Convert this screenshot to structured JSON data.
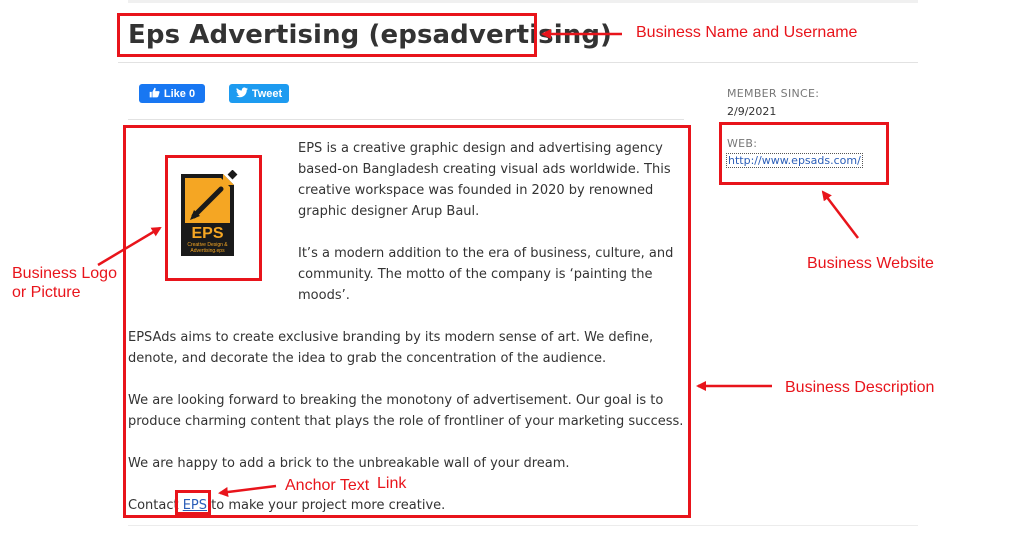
{
  "profile": {
    "title": "Eps Advertising (epsadvertising)"
  },
  "share": {
    "like_label": "Like 0",
    "tweet_label": "Tweet"
  },
  "sidebar": {
    "member_since_label": "MEMBER SINCE:",
    "member_since_value": "2/9/2021",
    "web_label": "WEB:",
    "web_url": "http://www.epsads.com/"
  },
  "logo": {
    "big": "EPS",
    "small1": "Creative Design &",
    "small2": "Advertising.eps"
  },
  "description": {
    "p1_lines": [
      "EPS is a creative graphic design and advertising agency",
      "based-on Bangladesh creating visual ads worldwide. This",
      "creative workspace was founded in 2020 by renowned",
      "graphic designer Arup Baul."
    ],
    "p2_lines": [
      "It’s a modern addition to the era of business, culture, and",
      "community. The motto of the company is ‘painting the",
      "moods’."
    ],
    "p3_lines": [
      "EPSAds aims to create exclusive branding by its modern sense of art. We define,",
      "denote, and decorate the idea to grab the concentration of the audience."
    ],
    "p4_lines": [
      "We are looking forward to breaking the monotony of advertisement. Our goal is to",
      "produce charming content that plays the role of frontliner of your marketing success."
    ],
    "p5": "We are happy to add a brick to the unbreakable wall of your dream.",
    "contact_before": "Contact ",
    "contact_link": "EPS",
    "contact_after": " to make your project more creative."
  },
  "annotations": {
    "business_name": "Business Name and Username",
    "business_logo_1": "Business Logo",
    "business_logo_2": "or Picture",
    "business_website": "Business Website",
    "business_description": "Business Description",
    "anchor_text": "Anchor Text",
    "link": "Link"
  },
  "colors": {
    "annotation_red": "#e8141b",
    "like_blue": "#1877f2",
    "tweet_blue": "#1d9bf0",
    "link_blue": "#2b5eb8",
    "logo_orange": "#f5a623"
  }
}
